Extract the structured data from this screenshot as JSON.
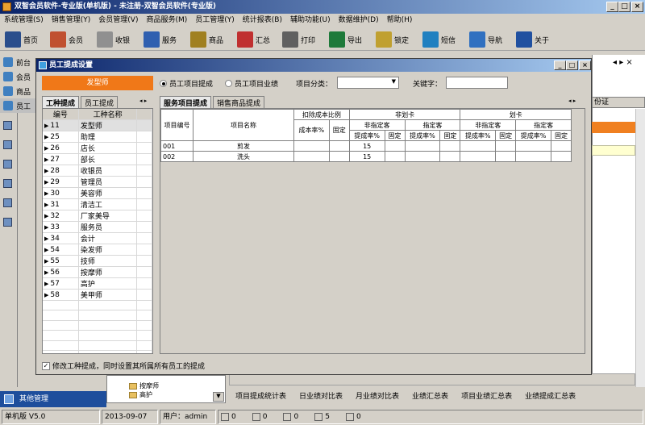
{
  "app": {
    "title": "双智会员软件-专业版(单机版) - 未注册-双智会员软件(专业版)"
  },
  "menu": [
    "系统管理(S)",
    "销售管理(Y)",
    "会员管理(V)",
    "商品服务(M)",
    "员工管理(Y)",
    "统计报表(B)",
    "辅助功能(U)",
    "数据维护(D)",
    "帮助(H)"
  ],
  "toolbar": [
    {
      "label": "首页",
      "icon": "monitor-icon",
      "color": "#2a4e8c"
    },
    {
      "label": "会员",
      "icon": "member-card-icon",
      "color": "#c05030"
    },
    {
      "label": "收银",
      "icon": "calculator-icon",
      "color": "#909090"
    },
    {
      "label": "服务",
      "icon": "books-icon",
      "color": "#3060b0"
    },
    {
      "label": "商品",
      "icon": "goods-icon",
      "color": "#a08020"
    },
    {
      "label": "汇总",
      "icon": "bar-chart-icon",
      "color": "#c03030"
    },
    {
      "label": "打印",
      "icon": "printer-icon",
      "color": "#606060"
    },
    {
      "label": "导出",
      "icon": "excel-icon",
      "color": "#1e7a3a"
    },
    {
      "label": "锁定",
      "icon": "lock-icon",
      "color": "#c0a030"
    },
    {
      "label": "短信",
      "icon": "sms-icon",
      "color": "#2080c0"
    },
    {
      "label": "导航",
      "icon": "navigation-icon",
      "color": "#3070c0"
    },
    {
      "label": "关于",
      "icon": "about-icon",
      "color": "#2050a0"
    }
  ],
  "left_nav": {
    "items": [
      "前台",
      "会员",
      "商品",
      "员工"
    ],
    "bottom": "其他管理"
  },
  "bg_window": {
    "col_header": "份证",
    "links": [
      "项目提成统计表",
      "日业绩对比表",
      "月业绩对比表",
      "业绩汇总表",
      "项目业绩汇总表",
      "业绩提成汇总表"
    ],
    "tree_items": [
      "按摩师",
      "高护"
    ]
  },
  "dialog": {
    "title": "员工提成设置",
    "selected_job": "发型师",
    "radio1": "员工项目提成",
    "radio2": "员工项目业绩",
    "category_label": "项目分类：",
    "keyword_label": "关键字：",
    "left_tabs": [
      "工种提成",
      "员工提成"
    ],
    "job_headers": [
      "编号",
      "工种名称"
    ],
    "jobs": [
      [
        "11",
        "发型师"
      ],
      [
        "25",
        "助理"
      ],
      [
        "26",
        "店长"
      ],
      [
        "27",
        "部长"
      ],
      [
        "28",
        "收银员"
      ],
      [
        "29",
        "管理员"
      ],
      [
        "30",
        "美容师"
      ],
      [
        "31",
        "清洁工"
      ],
      [
        "32",
        "厂家美导"
      ],
      [
        "33",
        "服务员"
      ],
      [
        "34",
        "会计"
      ],
      [
        "54",
        "染发师"
      ],
      [
        "55",
        "技师"
      ],
      [
        "56",
        "按摩师"
      ],
      [
        "57",
        "高护"
      ],
      [
        "58",
        "美甲师"
      ]
    ],
    "right_tabs": [
      "服务项目提成",
      "销售商品提成"
    ],
    "headers": {
      "id": "项目编号",
      "name": "项目名称",
      "deduct": "扣除成本比例",
      "nocard": "非划卡",
      "card": "划卡",
      "nonspec": "非指定客",
      "spec": "指定客",
      "rate": "提成率%",
      "fixed": "固定",
      "cost": "成本率%"
    },
    "rows": [
      [
        "001",
        "剪发",
        "15"
      ],
      [
        "002",
        "洗头",
        "15"
      ]
    ],
    "checkbox": "修改工种提成，同时设置其所属所有员工的提成"
  },
  "status": {
    "version": "单机版 V5.0",
    "date": "2013-09-07",
    "user": "用户：admin",
    "counts": [
      "0",
      "0",
      "0",
      "5",
      "0"
    ]
  }
}
